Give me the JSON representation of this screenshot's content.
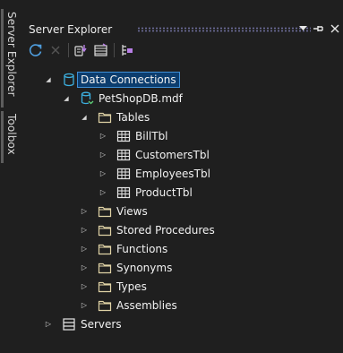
{
  "side_tabs": [
    "Server Explorer",
    "Toolbox"
  ],
  "panel": {
    "title": "Server Explorer",
    "title_icons": [
      "dropdown-arrow-icon",
      "pin-icon",
      "close-icon"
    ]
  },
  "toolbar": [
    "refresh-icon",
    "stop-icon",
    "connect-to-database-icon",
    "connect-to-server-icon",
    "sharepoint-icon"
  ],
  "tree": {
    "data_connections": "Data Connections",
    "db": "PetShopDB.mdf",
    "tables": "Tables",
    "table_items": [
      "BillTbl",
      "CustomersTbl",
      "EmployeesTbl",
      "ProductTbl"
    ],
    "folders": [
      "Views",
      "Stored Procedures",
      "Functions",
      "Synonyms",
      "Types",
      "Assemblies"
    ],
    "servers": "Servers"
  },
  "colors": {
    "background": "#1f1f1f",
    "selection_fill": "#0c3d6e",
    "selection_border": "#3f8fd6",
    "folder": "#e0d3a6",
    "database": "#3cb0e0",
    "icon_purple": "#b87fe6"
  }
}
